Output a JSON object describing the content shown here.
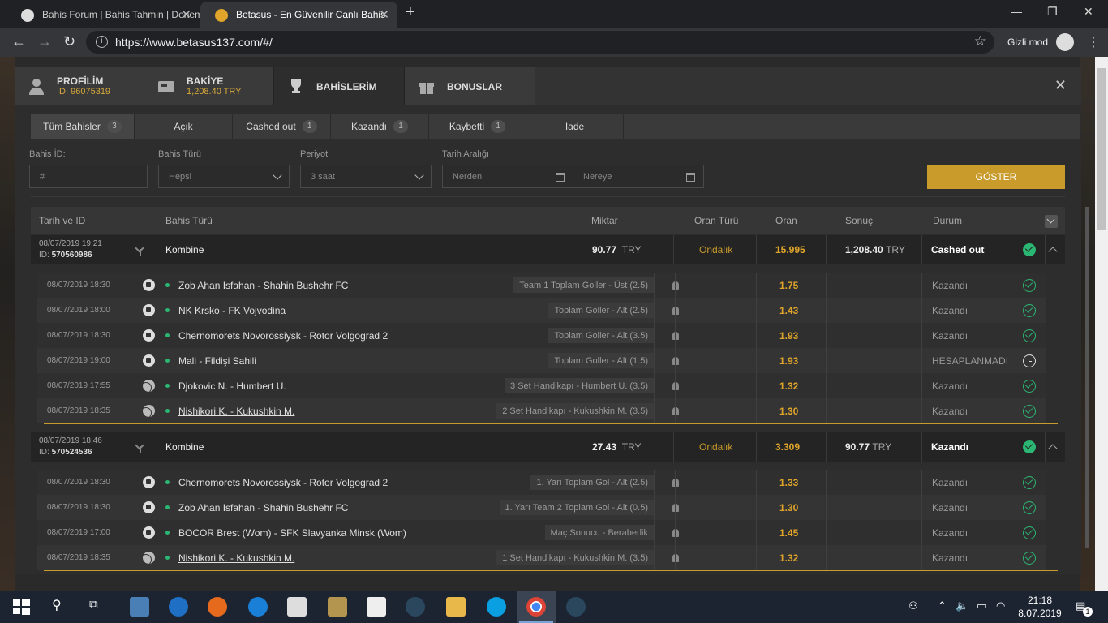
{
  "browser": {
    "tabs": [
      {
        "title": "Bahis Forum | Bahis Tahmin | Deneme",
        "active": false
      },
      {
        "title": "Betasus - En Güvenilir Canlı Bahis",
        "active": true
      }
    ],
    "url": "https://www.betasus137.com/#/",
    "incognito_label": "Gizli mod",
    "new_tab": "+",
    "window": {
      "min": "—",
      "max": "❐",
      "close": "✕"
    }
  },
  "account_tabs": [
    {
      "label": "PROFİLİM",
      "sub": "ID: 96075319",
      "icon": "user-icon"
    },
    {
      "label": "BAKİYE",
      "sub": "1,208.40 TRY",
      "icon": "wallet-icon"
    },
    {
      "label": "BAHİSLERİM",
      "sub": "",
      "icon": "trophy-icon",
      "active": true
    },
    {
      "label": "BONUSLAR",
      "sub": "",
      "icon": "gift-icon"
    }
  ],
  "close_label": "✕",
  "subtabs": [
    {
      "label": "Tüm Bahisler",
      "count": "3",
      "active": true
    },
    {
      "label": "Açık",
      "count": ""
    },
    {
      "label": "Cashed out",
      "count": "1"
    },
    {
      "label": "Kazandı",
      "count": "1"
    },
    {
      "label": "Kaybetti",
      "count": "1"
    },
    {
      "label": "Iade",
      "count": ""
    }
  ],
  "filters": {
    "bet_id_label": "Bahis İD:",
    "bet_id_placeholder": "#",
    "bet_type_label": "Bahis Türü",
    "bet_type_value": "Hepsi",
    "period_label": "Periyot",
    "period_value": "3 saat",
    "date_range_label": "Tarih Aralığı",
    "from_placeholder": "Nerden",
    "to_placeholder": "Nereye",
    "show_button": "GÖSTER"
  },
  "table": {
    "headers": [
      "Tarih ve ID",
      "Bahis Türü",
      "Miktar",
      "Oran Türü",
      "Oran",
      "Sonuç",
      "Durum"
    ]
  },
  "bets": [
    {
      "date": "08/07/2019 19:21",
      "id_label": "ID:",
      "id": "570560986",
      "type": "Kombine",
      "amount": "90.77",
      "currency": "TRY",
      "odds_type": "Ondalık",
      "odds": "15.995",
      "result": "1,208.40",
      "result_currency": "TRY",
      "status": "Cashed out",
      "legs": [
        {
          "date": "08/07/2019 18:30",
          "sport": "football",
          "event": "Zob Ahan Isfahan - Shahin Bushehr FC",
          "market": "Team 1 Toplam Goller - Üst (2.5)",
          "odds": "1.75",
          "status": "Kazandı",
          "icon": "check"
        },
        {
          "date": "08/07/2019 18:00",
          "sport": "football",
          "event": "NK Krsko - FK Vojvodina",
          "market": "Toplam Goller - Alt (2.5)",
          "odds": "1.43",
          "status": "Kazandı",
          "icon": "check"
        },
        {
          "date": "08/07/2019 18:30",
          "sport": "football",
          "event": "Chernomorets Novorossiysk - Rotor Volgograd 2",
          "market": "Toplam Goller - Alt (3.5)",
          "odds": "1.93",
          "status": "Kazandı",
          "icon": "check"
        },
        {
          "date": "08/07/2019 19:00",
          "sport": "football",
          "event": "Mali - Fildişi Sahili",
          "market": "Toplam Goller - Alt (1.5)",
          "odds": "1.93",
          "status": "HESAPLANMADI",
          "icon": "clock"
        },
        {
          "date": "08/07/2019 17:55",
          "sport": "tennis",
          "event": "Djokovic N. - Humbert U.",
          "market": "3 Set Handikapı - Humbert U. (3.5)",
          "odds": "1.32",
          "status": "Kazandı",
          "icon": "check"
        },
        {
          "date": "08/07/2019 18:35",
          "sport": "tennis",
          "event": "Nishikori K. - Kukushkin M.",
          "market": "2 Set Handikapı - Kukushkin M. (3.5)",
          "odds": "1.30",
          "status": "Kazandı",
          "icon": "check",
          "underline": true
        }
      ]
    },
    {
      "date": "08/07/2019 18:46",
      "id_label": "ID:",
      "id": "570524536",
      "type": "Kombine",
      "amount": "27.43",
      "currency": "TRY",
      "odds_type": "Ondalık",
      "odds": "3.309",
      "result": "90.77",
      "result_currency": "TRY",
      "status": "Kazandı",
      "legs": [
        {
          "date": "08/07/2019 18:30",
          "sport": "football",
          "event": "Chernomorets Novorossiysk - Rotor Volgograd 2",
          "market": "1. Yarı Toplam Gol - Alt (2.5)",
          "odds": "1.33",
          "status": "Kazandı",
          "icon": "check"
        },
        {
          "date": "08/07/2019 18:30",
          "sport": "football",
          "event": "Zob Ahan Isfahan - Shahin Bushehr FC",
          "market": "1. Yarı Team 2 Toplam Gol - Alt (0.5)",
          "odds": "1.30",
          "status": "Kazandı",
          "icon": "check"
        },
        {
          "date": "08/07/2019 17:00",
          "sport": "football",
          "event": "BOCOR Brest (Wom) - SFK Slavyanka Minsk (Wom)",
          "market": "Maç Sonucu - Beraberlik",
          "odds": "1.45",
          "status": "Kazandı",
          "icon": "check"
        },
        {
          "date": "08/07/2019 18:35",
          "sport": "tennis",
          "event": "Nishikori K. - Kukushkin M.",
          "market": "1 Set Handikapı - Kukushkin M. (3.5)",
          "odds": "1.32",
          "status": "Kazandı",
          "icon": "check",
          "underline": true
        }
      ]
    }
  ],
  "taskbar": {
    "time": "21:18",
    "date": "8.07.2019",
    "notification_count": "1"
  },
  "colors": {
    "accent": "#c89b2b",
    "odds": "#e0a52a",
    "win": "#2bb673"
  }
}
